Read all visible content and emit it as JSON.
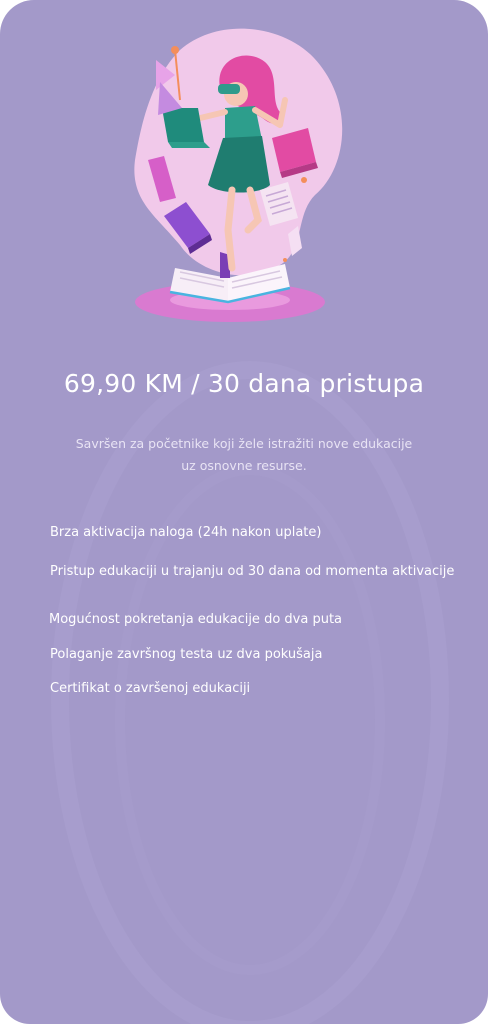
{
  "pricing_card": {
    "title": "69,90 KM / 30 dana pristupa",
    "description": "Savršen za početnike koji žele istražiti nove edukacije uz osnovne resurse.",
    "features": [
      "Brza aktivacija naloga (24h nakon uplate)",
      "Pristup edukaciji u trajanju od 30 dana od momenta aktivacije",
      "Mogućnost pokretanja edukacije do dva puta",
      "Polaganje završnog testa uz dva pokušaja",
      "Certifikat o završenoj edukaciji"
    ],
    "background_color": "#a399c9",
    "illustration_icon": "woman-reading-books-illustration"
  }
}
